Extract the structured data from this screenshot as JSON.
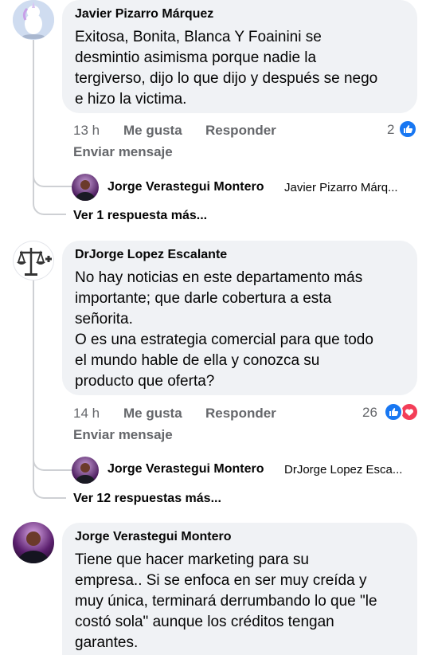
{
  "comments": [
    {
      "author": "Javier Pizarro Márquez",
      "lines": [
        "Exitosa, Bonita, Blanca Y Foainini  se",
        "desmintio asimisma porque nadie la",
        "tergiverso, dijo lo que dijo y después se nego",
        "e hizo la victima."
      ],
      "time": "13 h",
      "like": "Me gusta",
      "reply": "Responder",
      "send": "Enviar mensaje",
      "reactions": "2",
      "reply_preview": {
        "author": "Jorge Verastegui Montero",
        "snippet": "Javier Pizarro Márq..."
      },
      "more_replies": "Ver 1 respuesta más..."
    },
    {
      "author": "DrJorge Lopez Escalante",
      "lines": [
        "No hay noticias en este departamento más",
        "importante; que darle cobertura a esta",
        "señorita.",
        "O es una estrategia comercial para que todo",
        "el mundo hable de ella y conozca su",
        "producto que oferta?"
      ],
      "time": "14 h",
      "like": "Me gusta",
      "reply": "Responder",
      "send": "Enviar mensaje",
      "reactions": "26",
      "reply_preview": {
        "author": "Jorge Verastegui Montero",
        "snippet": "DrJorge Lopez Esca..."
      },
      "more_replies": "Ver 12 respuestas más..."
    },
    {
      "author": "Jorge Verastegui Montero",
      "lines": [
        "Tiene que hacer marketing para su",
        "empresa.. Si se enfoca en ser muy creída y",
        "muy única, terminará derrumbando lo que \"le",
        "costó sola\" aunque los créditos tengan",
        "garantes."
      ]
    }
  ],
  "colors": {
    "like_blue": "#1877f2",
    "love_red": "#f33e58",
    "bubble": "#f0f2f5",
    "meta_gray": "#65676b"
  }
}
